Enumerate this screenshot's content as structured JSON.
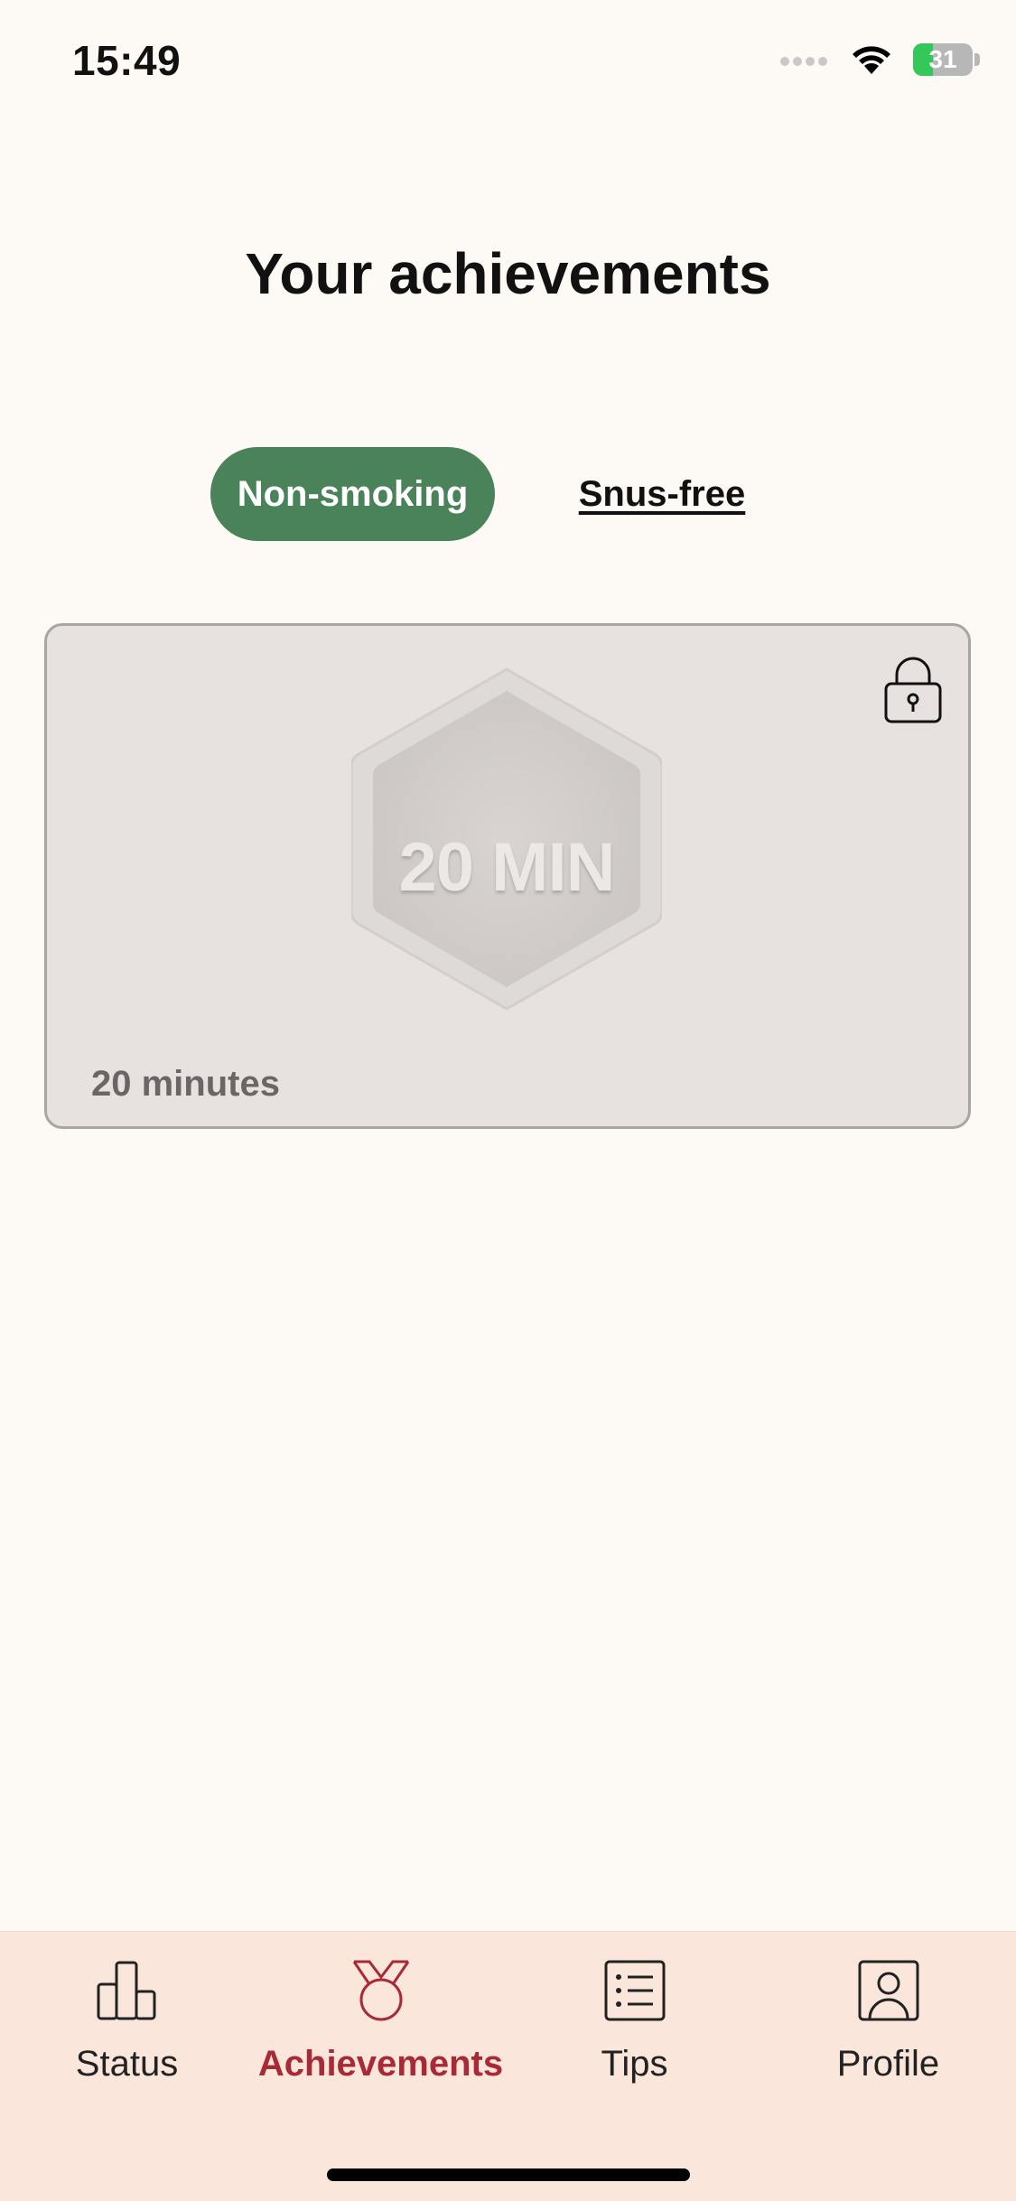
{
  "status_bar": {
    "time": "15:49",
    "battery": "31"
  },
  "page": {
    "title": "Your achievements"
  },
  "tabs": [
    {
      "label": "Non-smoking",
      "active": true
    },
    {
      "label": "Snus-free",
      "active": false
    }
  ],
  "achievement_card": {
    "badge_text": "20 MIN",
    "label": "20 minutes",
    "locked": true
  },
  "nav": [
    {
      "label": "Status",
      "icon": "bar-chart-icon",
      "active": false
    },
    {
      "label": "Achievements",
      "icon": "medal-icon",
      "active": true
    },
    {
      "label": "Tips",
      "icon": "list-icon",
      "active": false
    },
    {
      "label": "Profile",
      "icon": "person-icon",
      "active": false
    }
  ],
  "colors": {
    "background": "#fdf9f4",
    "accent_green": "#4a8259",
    "accent_red": "#a72a36",
    "tabbar_background": "#fae6da",
    "card_background": "#e7e1df"
  }
}
